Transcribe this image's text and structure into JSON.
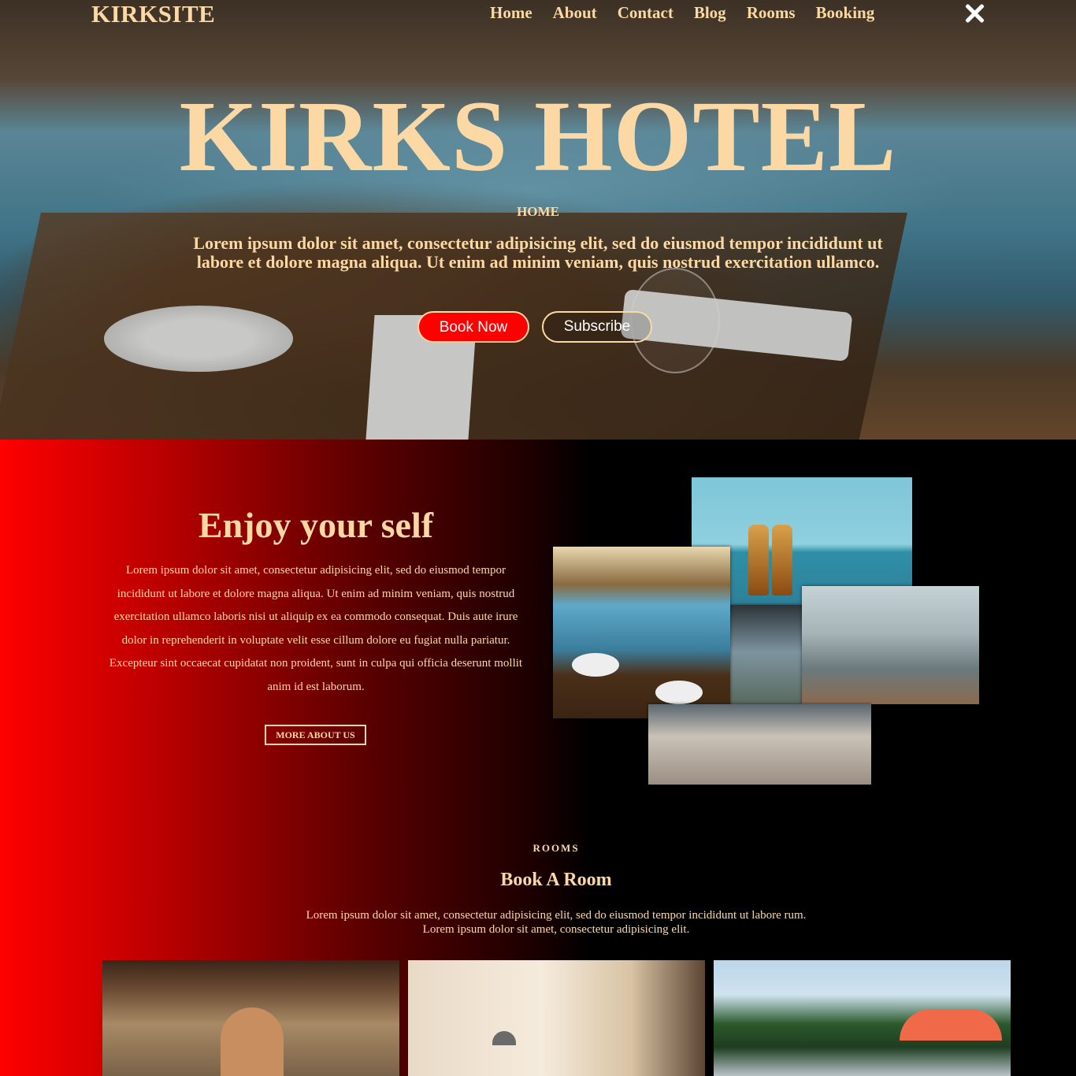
{
  "nav": {
    "logo": "KIRKSITE",
    "links": [
      "Home",
      "About",
      "Contact",
      "Blog",
      "Rooms",
      "Booking"
    ]
  },
  "hero": {
    "title": "KIRKS HOTEL",
    "kicker": "HOME",
    "text": "Lorem ipsum dolor sit amet, consectetur adipisicing elit, sed do eiusmod tempor incididunt ut labore et dolore magna aliqua. Ut enim ad minim veniam, quis nostrud exercitation ullamco.",
    "book_label": "Book Now",
    "subscribe_label": "Subscribe"
  },
  "about": {
    "title": "Enjoy your self",
    "text": "Lorem ipsum dolor sit amet, consectetur adipisicing elit, sed do eiusmod tempor incididunt ut labore et dolore magna aliqua. Ut enim ad minim veniam, quis nostrud exercitation ullamco laboris nisi ut aliquip ex ea commodo consequat. Duis aute irure dolor in reprehenderit in voluptate velit esse cillum dolore eu fugiat nulla pariatur. Excepteur sint occaecat cupidatat non proident, sunt in culpa qui officia deserunt mollit anim id est laborum.",
    "button_label": "MORE ABOUT US"
  },
  "rooms": {
    "kicker": "ROOMS",
    "title": "Book A Room",
    "text_line1": "Lorem ipsum dolor sit amet, consectetur adipisicing elit, sed do eiusmod tempor incididunt ut labore rum.",
    "text_line2": "Lorem ipsum dolor sit amet, consectetur adipisicing elit."
  },
  "colors": {
    "accent": "#fcd9a4",
    "primary_red": "#ff0000",
    "background": "#000000"
  }
}
